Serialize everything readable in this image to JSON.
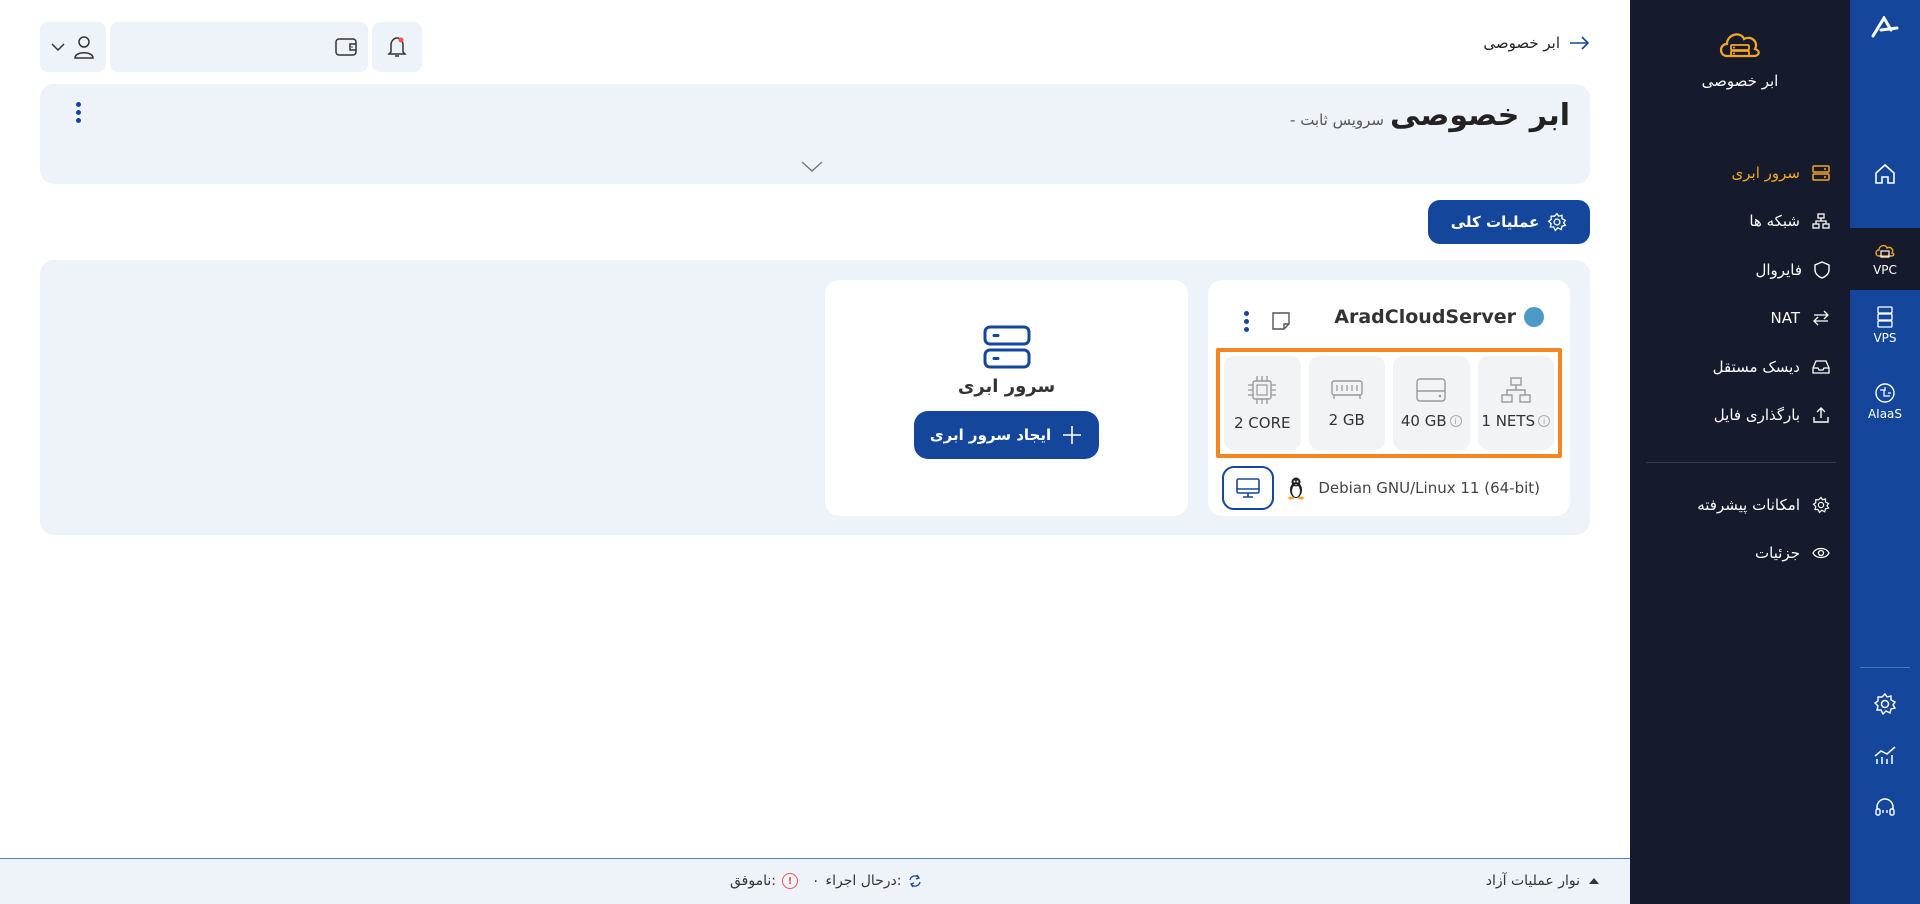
{
  "brand": {
    "title": "ابر خصوصی"
  },
  "rail": {
    "items": [
      {
        "label": "",
        "icon": "home-icon"
      },
      {
        "label": "VPC",
        "icon": "cloud-server-icon"
      },
      {
        "label": "VPS",
        "icon": "vps-icon"
      },
      {
        "label": "AIaaS",
        "icon": "ai-icon"
      }
    ],
    "bottom": [
      {
        "icon": "settings-icon"
      },
      {
        "icon": "analytics-icon"
      },
      {
        "icon": "support-icon"
      }
    ]
  },
  "menu": {
    "items": [
      {
        "label": "سرور ابری",
        "icon": "server-icon",
        "active": true
      },
      {
        "label": "شبکه ها",
        "icon": "network-icon"
      },
      {
        "label": "فایروال",
        "icon": "shield-icon"
      },
      {
        "label": "NAT",
        "icon": "nat-icon"
      },
      {
        "label": "دیسک مستقل",
        "icon": "disk-icon"
      },
      {
        "label": "بارگذاری فایل",
        "icon": "upload-icon"
      }
    ],
    "secondary": [
      {
        "label": "امکانات پیشرفته",
        "icon": "gear-icon"
      },
      {
        "label": "جزئیات",
        "icon": "eye-icon"
      }
    ]
  },
  "topbar": {
    "breadcrumb": "ابر خصوصی"
  },
  "header": {
    "title": "ابر خصوصی",
    "subtitle": "- سرویس ثابت"
  },
  "actions": {
    "ops_label": "عملیات کلی"
  },
  "server": {
    "name": "AradCloudServer",
    "status_color": "#4d9ac7",
    "specs": [
      {
        "label": "1 NETS",
        "icon": "network-icon",
        "info": true
      },
      {
        "label": "40 GB",
        "icon": "disk-icon",
        "info": true
      },
      {
        "label": "2 GB",
        "icon": "ram-icon",
        "info": false
      },
      {
        "label": "2 CORE",
        "icon": "cpu-icon",
        "info": false
      }
    ],
    "os": "Debian GNU/Linux 11 (64-bit)"
  },
  "create": {
    "title": "سرور ابری",
    "button": "ایجاد سرور ابری"
  },
  "bottombar": {
    "toggle": "نوار عملیات آزاد",
    "running_label": "درحال اجراء:",
    "running_value": "۰",
    "failed_label": "ناموفق:"
  },
  "colors": {
    "primary": "#14479c",
    "accent": "#f5a623",
    "highlight": "#f5861f",
    "sidebar": "#151b2c"
  }
}
